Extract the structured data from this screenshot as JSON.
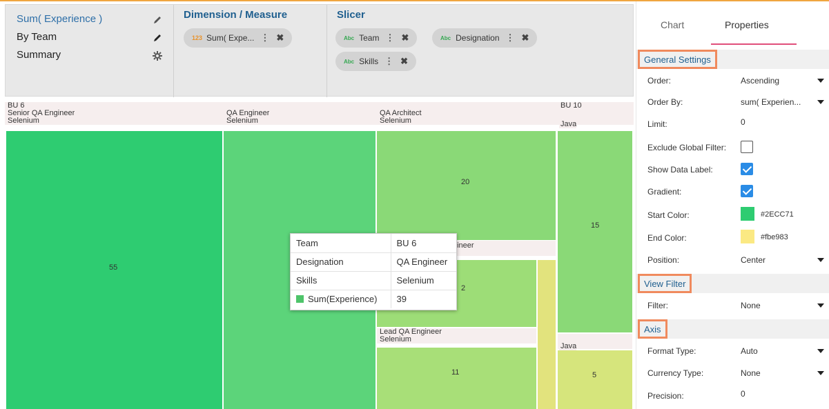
{
  "header": {
    "summary": {
      "items": [
        {
          "label": "Sum( Experience )",
          "icon": "pencil-icon"
        },
        {
          "label": "By Team",
          "icon": "pencil-icon"
        },
        {
          "label": "Summary",
          "icon": "gear-icon"
        }
      ]
    },
    "dimension": {
      "title": "Dimension / Measure",
      "chips": [
        {
          "type": "123",
          "label": "Sum( Expe..."
        }
      ]
    },
    "slicer": {
      "title": "Slicer",
      "chips": [
        {
          "type": "Abc",
          "label": "Team"
        },
        {
          "type": "Abc",
          "label": "Designation"
        },
        {
          "type": "Abc",
          "label": "Skills"
        }
      ]
    }
  },
  "treemap": {
    "cells": [
      {
        "labels": [
          "BU 6",
          "Senior QA Engineer",
          "Selenium"
        ],
        "value": "55",
        "color": "#2ecc71"
      },
      {
        "labels": [
          "",
          "QA Engineer",
          "Selenium"
        ],
        "value": "",
        "color": "#5cd47a"
      },
      {
        "labels": [
          "",
          "QA Architect",
          "Selenium"
        ],
        "value": "20",
        "color": "#8ad977"
      },
      {
        "labels": [
          "",
          "gineer",
          ""
        ],
        "value": "2",
        "color": "#9ddd77"
      },
      {
        "labels": [
          "",
          "Lead QA Engineer",
          "Selenium"
        ],
        "value": "11",
        "color": "#a8df78"
      },
      {
        "labels": [
          "BU 10",
          "",
          "Java"
        ],
        "value": "15",
        "color": "#8ad977"
      },
      {
        "labels": [
          "",
          "",
          "Java"
        ],
        "value": "5",
        "color": "#d6e57c"
      }
    ],
    "tooltip": {
      "rows": [
        {
          "key": "Team",
          "value": "BU 6"
        },
        {
          "key": "Designation",
          "value": "QA Engineer"
        },
        {
          "key": "Skills",
          "value": "Selenium"
        },
        {
          "key": "Sum(Experience)",
          "value": "39",
          "swatch_color": "#4ec46a"
        }
      ]
    }
  },
  "panel": {
    "tabs": [
      "Chart",
      "Properties"
    ],
    "active_tab": "Properties",
    "general": {
      "title": "General Settings",
      "order_label": "Order:",
      "order_value": "Ascending",
      "order_by_label": "Order By:",
      "order_by_value": "sum( Experien...",
      "limit_label": "Limit:",
      "limit_value": "0",
      "exclude_label": "Exclude Global Filter:",
      "exclude_checked": false,
      "show_label_label": "Show Data Label:",
      "show_label_checked": true,
      "gradient_label": "Gradient:",
      "gradient_checked": true,
      "start_color_label": "Start Color:",
      "start_color": "#2ECC71",
      "end_color_label": "End Color:",
      "end_color": "#fbe983",
      "position_label": "Position:",
      "position_value": "Center"
    },
    "view_filter": {
      "title": "View Filter",
      "filter_label": "Filter:",
      "filter_value": "None"
    },
    "axis": {
      "title": "Axis",
      "format_label": "Format Type:",
      "format_value": "Auto",
      "currency_label": "Currency Type:",
      "currency_value": "None",
      "precision_label": "Precision:",
      "precision_value": "0"
    }
  }
}
